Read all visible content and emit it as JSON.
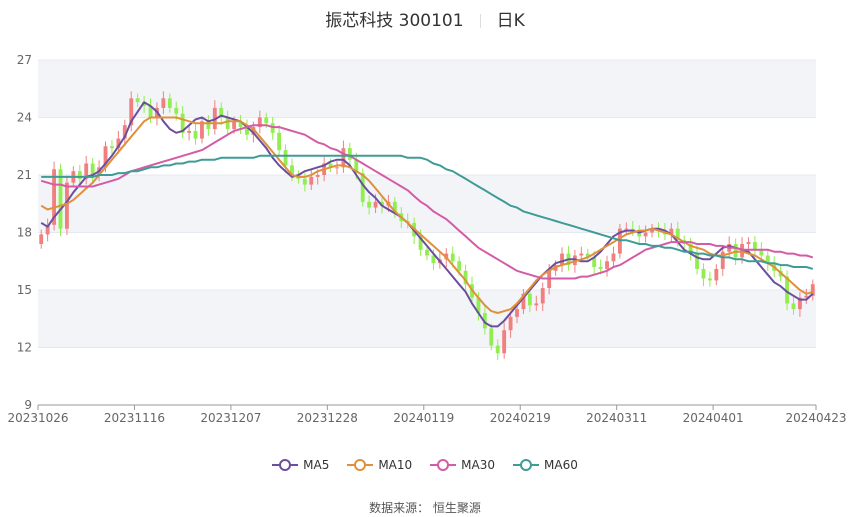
{
  "title": {
    "name": "振芯科技 300101",
    "period": "日K"
  },
  "source": "数据来源： 恒生聚源",
  "colors": {
    "up": "#f08080",
    "down": "#90ee50",
    "grid": "#e6e8ef",
    "band": "#f3f4f8",
    "axis": "#666666"
  },
  "chart_data": {
    "type": "line",
    "ylim": [
      9,
      27
    ],
    "yticks": [
      9,
      12,
      15,
      18,
      21,
      24,
      27
    ],
    "xtick_labels": [
      "20231026",
      "20231116",
      "20231207",
      "20231228",
      "20240119",
      "20240219",
      "20240311",
      "20240401",
      "20240423"
    ],
    "xtick_index": [
      0,
      15,
      30,
      45,
      60,
      75,
      90,
      105,
      120
    ],
    "candles_close": [
      17.9,
      18.4,
      21.3,
      18.2,
      20.6,
      21.2,
      20.8,
      21.6,
      21.0,
      21.4,
      22.5,
      22.4,
      22.9,
      23.6,
      25.0,
      24.8,
      24.6,
      24.0,
      24.5,
      25.0,
      24.5,
      24.2,
      23.2,
      23.3,
      22.9,
      23.8,
      23.4,
      24.5,
      24.0,
      23.4,
      23.8,
      23.5,
      23.1,
      23.5,
      24.0,
      23.7,
      23.2,
      22.3,
      21.5,
      21.0,
      20.8,
      20.5,
      20.9,
      21.0,
      21.6,
      21.4,
      21.4,
      22.4,
      21.8,
      21.1,
      19.6,
      19.3,
      19.6,
      19.4,
      19.6,
      19.0,
      18.6,
      18.5,
      17.8,
      17.1,
      16.8,
      16.4,
      16.6,
      16.9,
      16.5,
      16.0,
      15.3,
      14.6,
      13.8,
      13.0,
      12.1,
      11.7,
      12.9,
      13.6,
      14.0,
      14.8,
      14.2,
      14.3,
      15.1,
      16.0,
      16.3,
      16.9,
      16.3,
      16.8,
      16.9,
      16.7,
      16.2,
      16.1,
      16.5,
      16.9,
      18.2,
      18.2,
      18.1,
      17.8,
      18.0,
      18.2,
      18.1,
      17.9,
      18.2,
      17.6,
      17.4,
      16.9,
      16.1,
      15.6,
      15.5,
      16.1,
      17.0,
      17.4,
      16.7,
      17.4,
      17.5,
      17.1,
      16.8,
      16.4,
      16.0,
      15.7,
      14.3,
      14.0,
      14.6,
      14.7,
      15.3
    ],
    "series": [
      {
        "name": "MA5",
        "color": "#6b4f9e",
        "values": [
          18.5,
          18.3,
          18.8,
          19.2,
          19.6,
          20.1,
          20.5,
          20.9,
          21.0,
          21.2,
          21.6,
          22.0,
          22.5,
          23.0,
          23.8,
          24.3,
          24.8,
          24.6,
          24.3,
          23.8,
          23.4,
          23.2,
          23.3,
          23.6,
          23.9,
          24.0,
          23.8,
          23.9,
          24.1,
          24.0,
          23.9,
          23.8,
          23.5,
          23.2,
          22.8,
          22.4,
          21.9,
          21.5,
          21.2,
          20.9,
          21.0,
          21.2,
          21.3,
          21.4,
          21.5,
          21.7,
          21.8,
          21.8,
          21.5,
          21.0,
          20.5,
          20.1,
          19.8,
          19.4,
          19.2,
          19.0,
          18.8,
          18.5,
          18.1,
          17.7,
          17.3,
          16.9,
          16.5,
          16.1,
          15.7,
          15.3,
          14.9,
          14.3,
          13.8,
          13.3,
          13.1,
          13.1,
          13.4,
          13.8,
          14.2,
          14.6,
          15.0,
          15.4,
          15.8,
          16.1,
          16.4,
          16.5,
          16.6,
          16.6,
          16.5,
          16.5,
          16.7,
          17.0,
          17.4,
          17.8,
          18.0,
          18.1,
          18.1,
          18.0,
          18.1,
          18.2,
          18.2,
          18.1,
          17.9,
          17.5,
          17.1,
          16.9,
          16.7,
          16.6,
          16.6,
          16.9,
          17.2,
          17.3,
          17.2,
          17.1,
          17.0,
          16.6,
          16.2,
          15.8,
          15.4,
          15.2,
          14.9,
          14.7,
          14.5,
          14.5,
          14.8
        ]
      },
      {
        "name": "MA10",
        "color": "#e0903a",
        "values": [
          19.4,
          19.2,
          19.3,
          19.4,
          19.5,
          19.7,
          20.0,
          20.3,
          20.6,
          21.0,
          21.4,
          21.8,
          22.2,
          22.6,
          23.0,
          23.4,
          23.8,
          24.0,
          24.0,
          24.0,
          24.0,
          24.0,
          23.9,
          23.8,
          23.7,
          23.7,
          23.7,
          23.7,
          23.7,
          23.8,
          23.8,
          23.8,
          23.6,
          23.4,
          23.0,
          22.6,
          22.2,
          21.8,
          21.4,
          21.0,
          20.9,
          20.9,
          21.0,
          21.2,
          21.3,
          21.4,
          21.5,
          21.5,
          21.4,
          21.2,
          21.0,
          20.7,
          20.3,
          19.9,
          19.5,
          19.1,
          18.8,
          18.5,
          18.2,
          17.9,
          17.6,
          17.3,
          17.0,
          16.7,
          16.3,
          15.9,
          15.5,
          15.0,
          14.6,
          14.2,
          13.9,
          13.8,
          13.9,
          14.0,
          14.3,
          14.7,
          15.1,
          15.5,
          15.8,
          16.0,
          16.2,
          16.3,
          16.4,
          16.5,
          16.6,
          16.7,
          16.9,
          17.1,
          17.3,
          17.5,
          17.7,
          17.9,
          18.0,
          18.1,
          18.1,
          18.2,
          18.1,
          18.0,
          17.9,
          17.7,
          17.5,
          17.3,
          17.2,
          17.1,
          16.9,
          16.8,
          16.8,
          16.9,
          17.0,
          17.0,
          16.9,
          16.8,
          16.6,
          16.4,
          16.2,
          15.9,
          15.6,
          15.3,
          15.0,
          14.8,
          14.9
        ]
      },
      {
        "name": "MA30",
        "color": "#d45ba5",
        "values": [
          20.7,
          20.6,
          20.5,
          20.5,
          20.4,
          20.4,
          20.4,
          20.4,
          20.4,
          20.5,
          20.6,
          20.7,
          20.8,
          21.0,
          21.2,
          21.3,
          21.4,
          21.5,
          21.6,
          21.7,
          21.8,
          21.9,
          22.0,
          22.1,
          22.2,
          22.3,
          22.5,
          22.7,
          22.9,
          23.1,
          23.3,
          23.4,
          23.5,
          23.6,
          23.6,
          23.6,
          23.5,
          23.5,
          23.4,
          23.3,
          23.2,
          23.1,
          22.9,
          22.7,
          22.6,
          22.4,
          22.3,
          22.1,
          22.0,
          21.8,
          21.6,
          21.4,
          21.2,
          21.0,
          20.8,
          20.6,
          20.4,
          20.2,
          19.9,
          19.6,
          19.4,
          19.1,
          18.9,
          18.7,
          18.4,
          18.1,
          17.8,
          17.5,
          17.2,
          17.0,
          16.8,
          16.6,
          16.4,
          16.2,
          16.0,
          15.9,
          15.8,
          15.7,
          15.6,
          15.6,
          15.6,
          15.6,
          15.6,
          15.6,
          15.7,
          15.7,
          15.8,
          15.9,
          16.0,
          16.2,
          16.3,
          16.5,
          16.7,
          16.9,
          17.1,
          17.2,
          17.3,
          17.4,
          17.5,
          17.5,
          17.5,
          17.5,
          17.4,
          17.4,
          17.4,
          17.3,
          17.3,
          17.2,
          17.2,
          17.1,
          17.1,
          17.1,
          17.1,
          17.1,
          17.0,
          17.0,
          16.9,
          16.9,
          16.8,
          16.8,
          16.7
        ]
      },
      {
        "name": "MA60",
        "color": "#3e9b95",
        "values": [
          20.9,
          20.9,
          20.9,
          20.9,
          20.9,
          20.9,
          20.9,
          20.9,
          20.9,
          21.0,
          21.0,
          21.0,
          21.1,
          21.1,
          21.2,
          21.2,
          21.3,
          21.4,
          21.4,
          21.5,
          21.5,
          21.6,
          21.6,
          21.7,
          21.7,
          21.8,
          21.8,
          21.8,
          21.9,
          21.9,
          21.9,
          21.9,
          21.9,
          21.9,
          22.0,
          22.0,
          22.0,
          22.0,
          22.0,
          22.0,
          22.0,
          22.0,
          22.0,
          22.0,
          22.0,
          22.0,
          22.0,
          22.0,
          22.0,
          22.0,
          22.0,
          22.0,
          22.0,
          22.0,
          22.0,
          22.0,
          22.0,
          21.9,
          21.9,
          21.9,
          21.8,
          21.6,
          21.5,
          21.3,
          21.2,
          21.0,
          20.8,
          20.6,
          20.4,
          20.2,
          20.0,
          19.8,
          19.6,
          19.4,
          19.3,
          19.1,
          19.0,
          18.9,
          18.8,
          18.7,
          18.6,
          18.5,
          18.4,
          18.3,
          18.2,
          18.1,
          18.0,
          17.9,
          17.8,
          17.7,
          17.6,
          17.6,
          17.5,
          17.4,
          17.4,
          17.3,
          17.3,
          17.2,
          17.2,
          17.1,
          17.0,
          17.0,
          16.9,
          16.9,
          16.8,
          16.8,
          16.7,
          16.7,
          16.6,
          16.6,
          16.5,
          16.5,
          16.5,
          16.4,
          16.4,
          16.3,
          16.3,
          16.2,
          16.2,
          16.2,
          16.1
        ]
      }
    ],
    "legend_position": "bottom"
  }
}
